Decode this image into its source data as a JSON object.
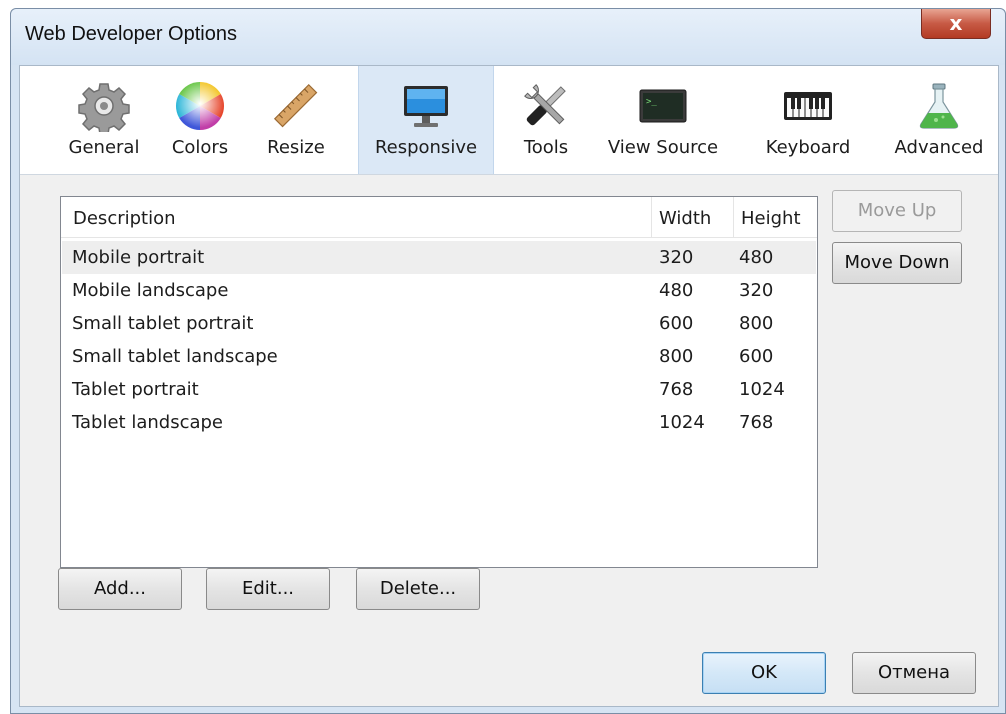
{
  "window": {
    "title": "Web Developer Options",
    "close_label": "x"
  },
  "toolbar": {
    "items": [
      {
        "label": "General",
        "icon": "gear-icon"
      },
      {
        "label": "Colors",
        "icon": "color-wheel-icon"
      },
      {
        "label": "Resize",
        "icon": "ruler-icon"
      },
      {
        "label": "Responsive",
        "icon": "monitor-icon",
        "active": true
      },
      {
        "label": "Tools",
        "icon": "wrench-screwdriver-icon"
      },
      {
        "label": "View Source",
        "icon": "terminal-icon"
      },
      {
        "label": "Keyboard",
        "icon": "keyboard-icon"
      },
      {
        "label": "Advanced",
        "icon": "flask-icon"
      }
    ]
  },
  "list": {
    "headers": {
      "description": "Description",
      "width": "Width",
      "height": "Height"
    },
    "rows": [
      {
        "description": "Mobile portrait",
        "width": "320",
        "height": "480",
        "selected": true
      },
      {
        "description": "Mobile landscape",
        "width": "480",
        "height": "320"
      },
      {
        "description": "Small tablet portrait",
        "width": "600",
        "height": "800"
      },
      {
        "description": "Small tablet landscape",
        "width": "800",
        "height": "600"
      },
      {
        "description": "Tablet portrait",
        "width": "768",
        "height": "1024"
      },
      {
        "description": "Tablet landscape",
        "width": "1024",
        "height": "768"
      }
    ]
  },
  "buttons": {
    "move_up": "Move Up",
    "move_down": "Move Down",
    "add": "Add...",
    "edit": "Edit...",
    "delete": "Delete...",
    "ok": "OK",
    "cancel": "Отмена"
  },
  "colors": {
    "title_bar": "#dce8f5",
    "selected_tab": "#dbe8f6",
    "close_button": "#c75a45"
  }
}
